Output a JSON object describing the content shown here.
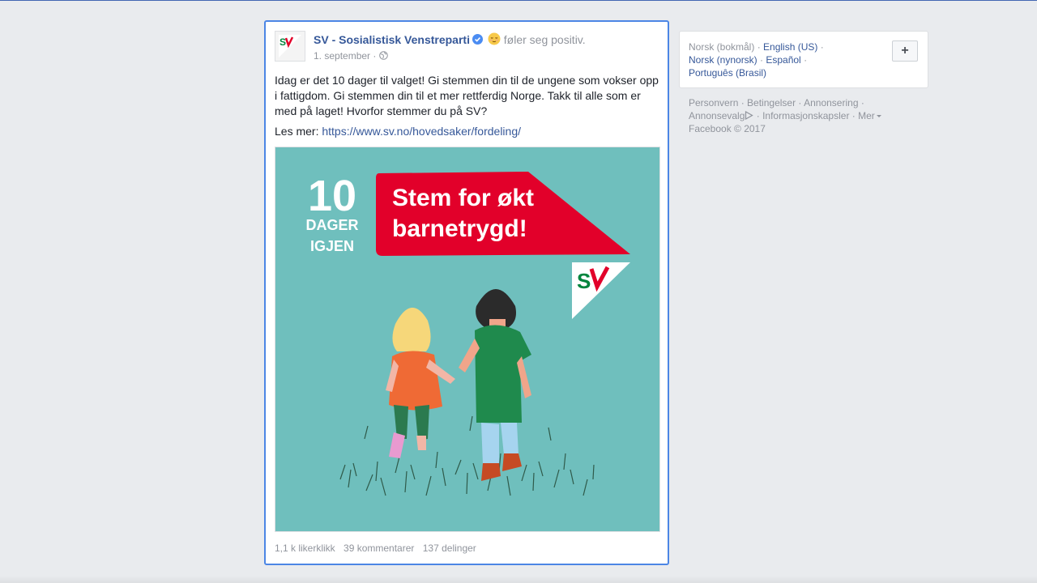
{
  "post": {
    "author": "SV - Sosialistisk Venstreparti",
    "feeling": "føler seg positiv.",
    "date": "1. september",
    "date_separator": "·",
    "text": "Idag er det 10 dager til valget! Gi stemmen din til de ungene som vokser opp i fattigdom. Gi stemmen din til et mer rettferdig Norge. Takk til alle som er med på laget! Hvorfor stemmer du på SV?",
    "read_more_label": "Les mer:",
    "read_more_link": "https://www.sv.no/hovedsaker/fordeling/",
    "image": {
      "counter_number": "10",
      "counter_line1": "DAGER",
      "counter_line2": "IGJEN",
      "banner_line1": "Stem for økt",
      "banner_line2": "barnetrygd!",
      "logo_text": "SV"
    },
    "stats": {
      "likes": "1,1 k likerklikk",
      "comments": "39 kommentarer",
      "shares": "137 delinger"
    }
  },
  "languages": {
    "current": "Norsk (bokmål)",
    "items": [
      "English (US)",
      "Norsk (nynorsk)",
      "Español",
      "Português (Brasil)"
    ],
    "add_label": "+"
  },
  "footer": {
    "links": [
      "Personvern",
      "Betingelser",
      "Annonsering",
      "Annonsevalg",
      "Informasjonskapsler",
      "Mer"
    ],
    "copyright": "Facebook © 2017"
  },
  "colors": {
    "link": "#365899",
    "accent_border": "#4c86e5",
    "image_bg": "#6fbfbd",
    "banner_red": "#e2002a",
    "logo_green": "#00843d"
  }
}
